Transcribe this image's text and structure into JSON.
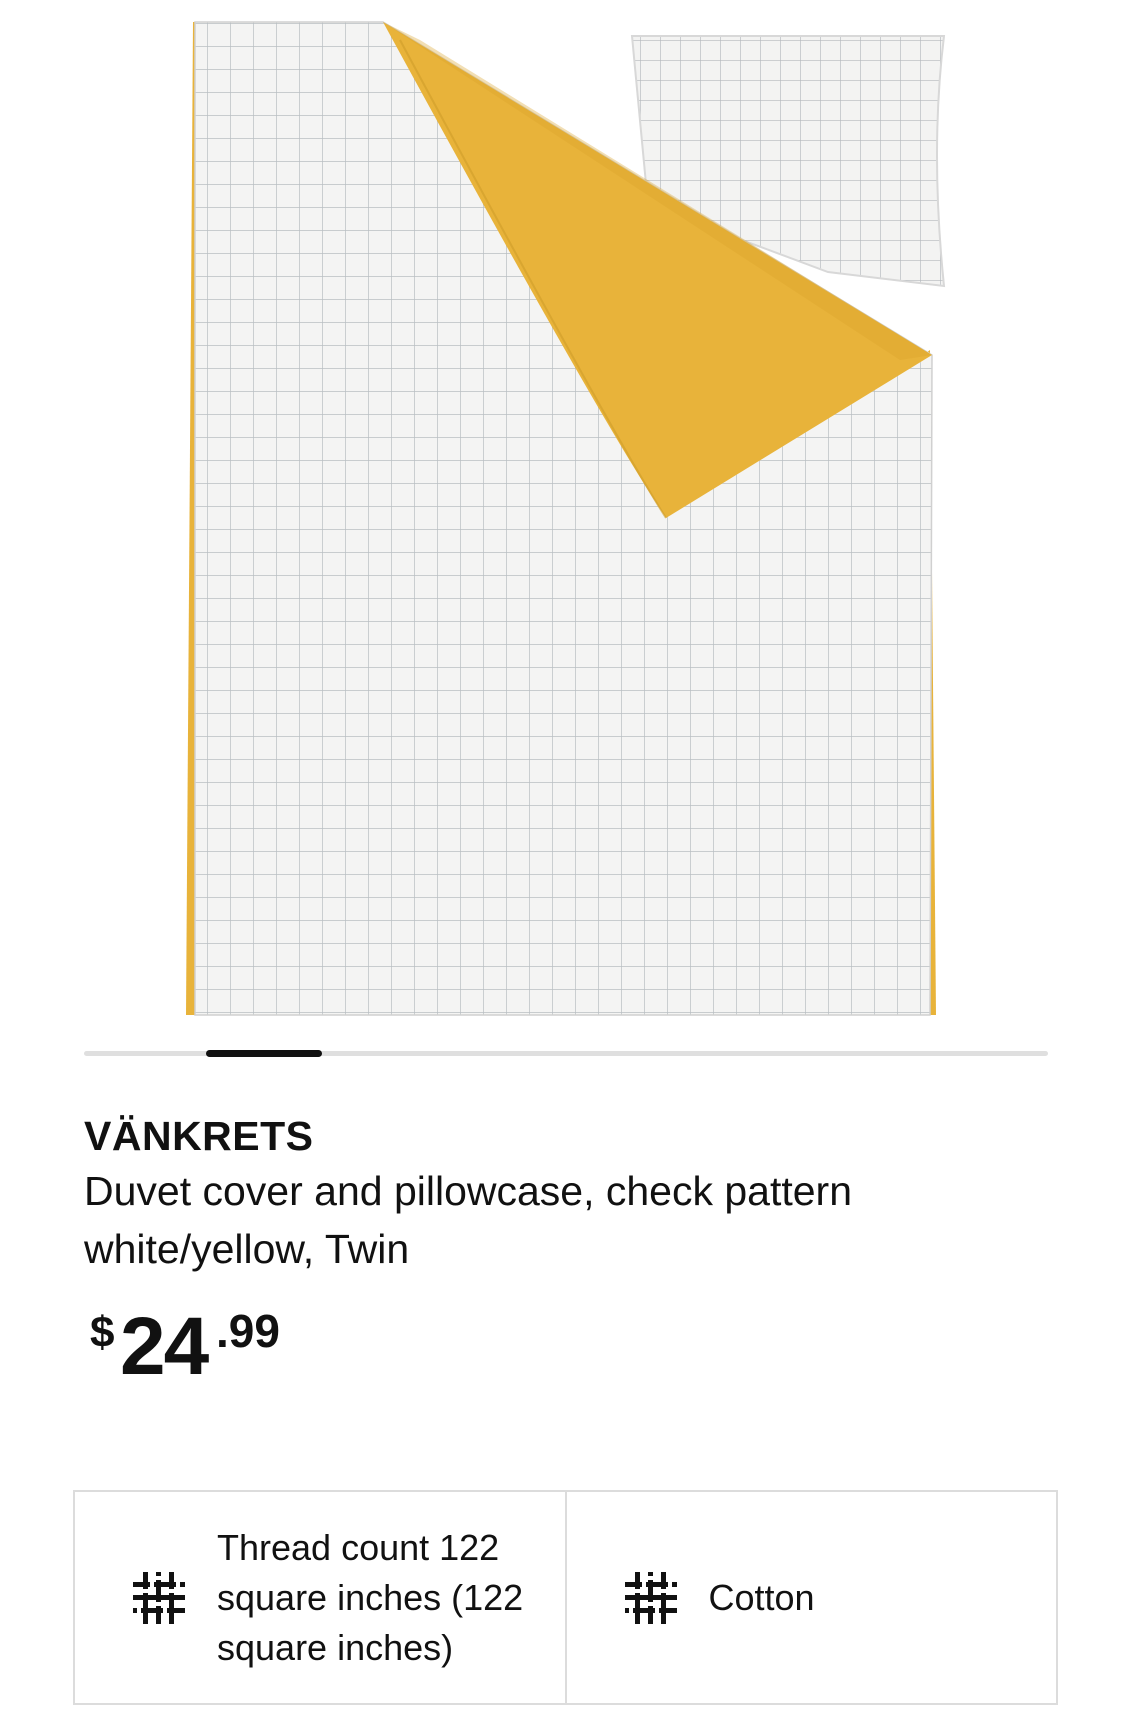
{
  "product": {
    "name": "VÄNKRETS",
    "description_line1": "Duvet cover and pillowcase, check pattern",
    "description_line2": "white/yellow, Twin",
    "image_alt": "Duvet cover and pillowcase with check pattern, white and yellow"
  },
  "price": {
    "currency": "$",
    "integer": "24",
    "decimal": ".99"
  },
  "carousel": {
    "current_fraction": 0.12
  },
  "features": [
    {
      "icon": "fabric-weave-icon",
      "label": "Thread count 122 square inches (122 square inches)"
    },
    {
      "icon": "fabric-weave-icon",
      "label": "Cotton"
    }
  ],
  "colors": {
    "yellow": "#E8B33A",
    "grid": "#bfc3c6",
    "text": "#111111",
    "border": "#dcdcdc"
  }
}
